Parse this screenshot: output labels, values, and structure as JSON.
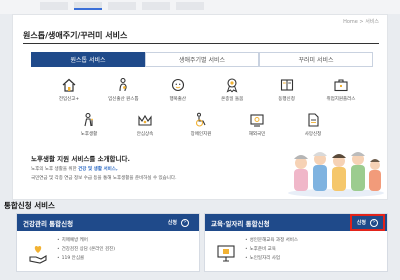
{
  "breadcrumb": "Home > 서비스",
  "panel_title": "원스톱/생애주기/꾸러미 서비스",
  "service_tabs": [
    {
      "label": "원스톱 서비스",
      "active": true
    },
    {
      "label": "생애주기별 서비스",
      "active": false
    },
    {
      "label": "꾸러미 서비스",
      "active": false
    }
  ],
  "services_row1": [
    {
      "label": "전입신고+",
      "icon": "house-icon"
    },
    {
      "label": "임신출산 원스톱",
      "icon": "pregnancy-icon"
    },
    {
      "label": "행복출산",
      "icon": "baby-icon"
    },
    {
      "label": "온종일 돌봄",
      "icon": "ribbon-icon"
    },
    {
      "label": "동행신청",
      "icon": "book-icon"
    },
    {
      "label": "취업지원플러스",
      "icon": "briefcase-icon"
    }
  ],
  "services_row2": [
    {
      "label": "노후생활",
      "icon": "elder-icon"
    },
    {
      "label": "안심상속",
      "icon": "inheritance-icon"
    },
    {
      "label": "장애인지원",
      "icon": "wheelchair-icon"
    },
    {
      "label": "재외국민",
      "icon": "global-icon"
    },
    {
      "label": "사망신청",
      "icon": "document-icon"
    }
  ],
  "notice": {
    "title": "노후생활 지원 서비스를 소개합니다.",
    "line1_pre": "노후의 노후 생활을 위한 ",
    "line1_link": "건강 및 생활 서비스,",
    "line2": "국민연금 및 각종 연금 정보 수급 등을 통해 노후생활을 준비하실 수 있습니다."
  },
  "section_title": "통합신청 서비스",
  "cards": [
    {
      "title": "건강관리 통합신청",
      "button": "신청",
      "items": [
        "치매예방 케어",
        "건강검진 상담 (온라인 검진)",
        "119 안심콜"
      ]
    },
    {
      "title": "교육·일자리 통합신청",
      "button": "신청",
      "items": [
        "성인문해교육 과정 서비스",
        "노후준비 교육",
        "노인일자리 사업"
      ]
    }
  ],
  "colors": {
    "accent": "#1f4a8a",
    "highlight": "#e2231a",
    "link": "#2e6bc4"
  }
}
